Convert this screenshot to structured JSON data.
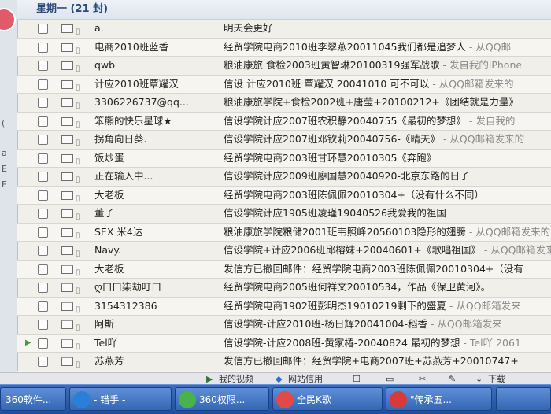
{
  "group": {
    "label": "星期一 (21 封)"
  },
  "rows": [
    {
      "from": "a.",
      "subject": "明天会更好",
      "summary": ""
    },
    {
      "from": "电商2010班蓝香",
      "subject": "经贸学院电商2010班李翠燕20011045我们都是追梦人",
      "summary": " - 从QQ邮"
    },
    {
      "from": "qwb",
      "subject": "粮油康旅 食检2003班黄智琳20100319强军战歌",
      "summary": " - 发自我的iPhone"
    },
    {
      "from": "计应2010班覃耀汉",
      "subject": "信设 计应2010班 覃耀汉 20041010 可不可以",
      "summary": " - 从QQ邮箱发来的"
    },
    {
      "from": "3306226737@qq...",
      "subject": "粮油康旅学院+食检2002班+唐莹+20100212+《团结就是力量》",
      "summary": ""
    },
    {
      "from": "笨熊的快乐星球★",
      "subject": "信设学院计应2007班农积静20040755《最初的梦想》",
      "summary": " - 发自我的"
    },
    {
      "from": "拐角向日葵.",
      "subject": "信设学院计应2007班邓钦莉20040756-《晴天》",
      "summary": " - 从QQ邮箱发来的"
    },
    {
      "from": "饭炒蛋",
      "subject": "经贸学院电商2003班甘环慧20010305《奔跑》",
      "summary": ""
    },
    {
      "from": "正在输入中...",
      "subject": "信设学院计应2009班廖国慧20040920-北京东路的日子",
      "summary": ""
    },
    {
      "from": "大老板",
      "subject": "经贸学院电商2003班陈佩佩20010304+（没有什么不同）",
      "summary": ""
    },
    {
      "from": "董子",
      "subject": "信设学院计应1905班凌瑾19040526我爱我的祖国",
      "summary": ""
    },
    {
      "from": "SEX 米4达",
      "subject": "粮油康旅学院粮储2001班韦照峰20560103隐形的翅膀",
      "summary": " - 从QQ邮箱发来的"
    },
    {
      "from": "Navy.",
      "subject": "信设学院+计应2006班邱榕妹+20040601+《歌唱祖国》",
      "summary": " - 从QQ邮箱发来"
    },
    {
      "from": "大老板",
      "subject": "发信方已撤回邮件：经贸学院电商2003班陈佩佩20010304+（没有",
      "summary": ""
    },
    {
      "from": "ღ口口柒劫叮口",
      "subject": "经贸学院电商2005班何祥文20010534，作品《保卫黄河》。",
      "summary": ""
    },
    {
      "from": "3154312386",
      "subject": "经贸学院电商1902班彭明杰19010219剩下的盛夏",
      "summary": " - 从QQ邮箱发来"
    },
    {
      "from": "阿斯",
      "subject": "信设学院-计应2010班-杨日辉20041004-稻香",
      "summary": " - 从QQ邮箱发来"
    },
    {
      "from": "Tel吖",
      "subject": "信设学院-计应2008班-黄家椿-20040824 最初的梦想",
      "summary": " - Tel吖 2061"
    },
    {
      "from": "苏燕芳",
      "subject": "发信方已撤回邮件：经贸学院+电商2007班+苏燕芳+20010747+",
      "summary": ""
    },
    {
      "from": "桃枝",
      "subject": "信设学院-计应2009班-梁瑶-20040919-《北京东路的日子》",
      "summary": ""
    }
  ],
  "statusbar": {
    "video": "我的视频",
    "trust": "网站信用",
    "download": "下载"
  },
  "taskbar": [
    {
      "label": "360软件...",
      "color": "#3aa84a"
    },
    {
      "label": "- 错手 -",
      "color": "#2a7fd8"
    },
    {
      "label": "360权限...",
      "color": "#49b24a"
    },
    {
      "label": "全民K歌",
      "color": "#e24a4a"
    },
    {
      "label": "\"传承五...",
      "color": "#d83a3a"
    }
  ],
  "left_tags": [
    "(",
    "a",
    "E",
    "E"
  ]
}
